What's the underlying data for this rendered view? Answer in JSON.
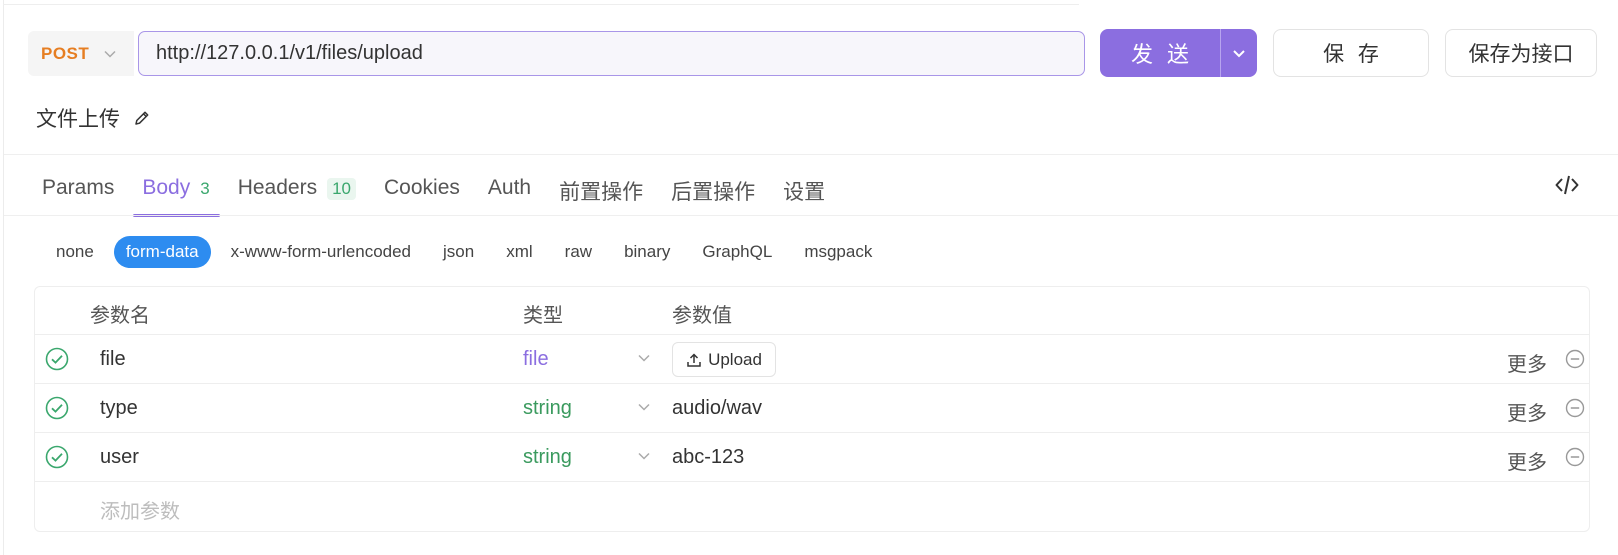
{
  "request": {
    "method": "POST",
    "url": "http://127.0.0.1/v1/files/upload",
    "name": "文件上传"
  },
  "actions": {
    "send": "发 送",
    "save": "保 存",
    "save_as_api": "保存为接口"
  },
  "tabs": [
    {
      "label": "Params",
      "count": ""
    },
    {
      "label": "Body",
      "count": "3"
    },
    {
      "label": "Headers",
      "count": "10"
    },
    {
      "label": "Cookies",
      "count": ""
    },
    {
      "label": "Auth",
      "count": ""
    },
    {
      "label": "前置操作",
      "count": ""
    },
    {
      "label": "后置操作",
      "count": ""
    },
    {
      "label": "设置",
      "count": ""
    }
  ],
  "body_types": [
    "none",
    "form-data",
    "x-www-form-urlencoded",
    "json",
    "xml",
    "raw",
    "binary",
    "GraphQL",
    "msgpack"
  ],
  "table": {
    "headers": {
      "name": "参数名",
      "type": "类型",
      "value": "参数值"
    },
    "rows": [
      {
        "name": "file",
        "type": "file",
        "value": "",
        "upload_label": "Upload",
        "more": "更多"
      },
      {
        "name": "type",
        "type": "string",
        "value": "audio/wav",
        "more": "更多"
      },
      {
        "name": "user",
        "type": "string",
        "value": "abc-123",
        "more": "更多"
      }
    ],
    "add_placeholder": "添加参数"
  },
  "colors": {
    "accent": "#8b6ee0",
    "method": "#e67e22",
    "active_type": "#2d8cf0",
    "check": "#3aa76d"
  }
}
